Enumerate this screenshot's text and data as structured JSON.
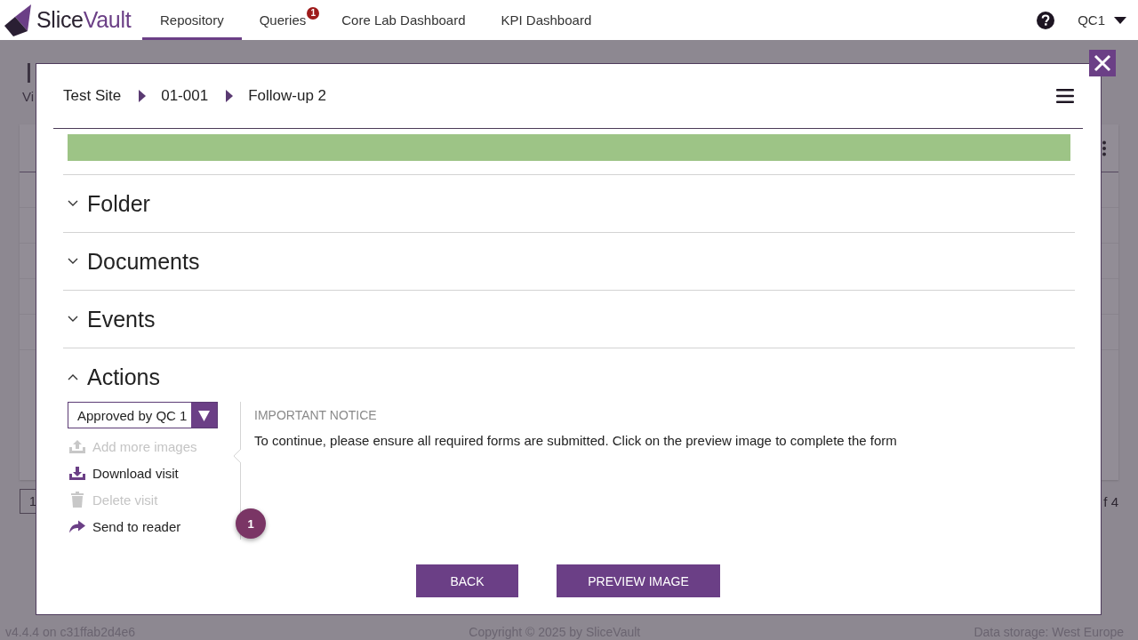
{
  "header": {
    "brand": [
      "Slice",
      "Vault"
    ],
    "nav": [
      {
        "label": "Repository",
        "selected": true
      },
      {
        "label": "Queries",
        "selected": false,
        "badge": "1"
      },
      {
        "label": "Core Lab Dashboard",
        "selected": false
      },
      {
        "label": "KPI Dashboard",
        "selected": false
      }
    ],
    "user": "QC1"
  },
  "background_page": {
    "title": "I",
    "subtitle": "Vi",
    "pagination": {
      "page": "1",
      "total": "f 4"
    }
  },
  "dialog": {
    "breadcrumb": [
      "Test Site",
      "01-001",
      "Follow-up 2"
    ],
    "sections": [
      {
        "title": "Folder",
        "expanded": false
      },
      {
        "title": "Documents",
        "expanded": false
      },
      {
        "title": "Events",
        "expanded": false
      },
      {
        "title": "Actions",
        "expanded": true,
        "actions": {
          "status": {
            "value": "Approved by QC 1"
          },
          "items": [
            {
              "kind": "upload",
              "label": "Add more images",
              "disabled": true
            },
            {
              "kind": "download",
              "label": "Download visit",
              "disabled": false
            },
            {
              "kind": "delete",
              "label": "Delete visit",
              "disabled": true
            },
            {
              "kind": "send",
              "label": "Send to reader",
              "disabled": false
            }
          ],
          "notice": {
            "heading": "IMPORTANT NOTICE",
            "text": "To continue, please ensure all required forms are submitted. Click on the preview image to complete the form"
          },
          "step_badge": "1"
        }
      }
    ],
    "buttons": [
      {
        "label": "BACK"
      },
      {
        "label": "PREVIEW IMAGE"
      }
    ]
  },
  "footer": {
    "version": "v4.4.4 on c31ffab2d4e6",
    "copyright": "Copyright © 2025 by SliceVault",
    "storage": "Data storage: West Europe"
  }
}
